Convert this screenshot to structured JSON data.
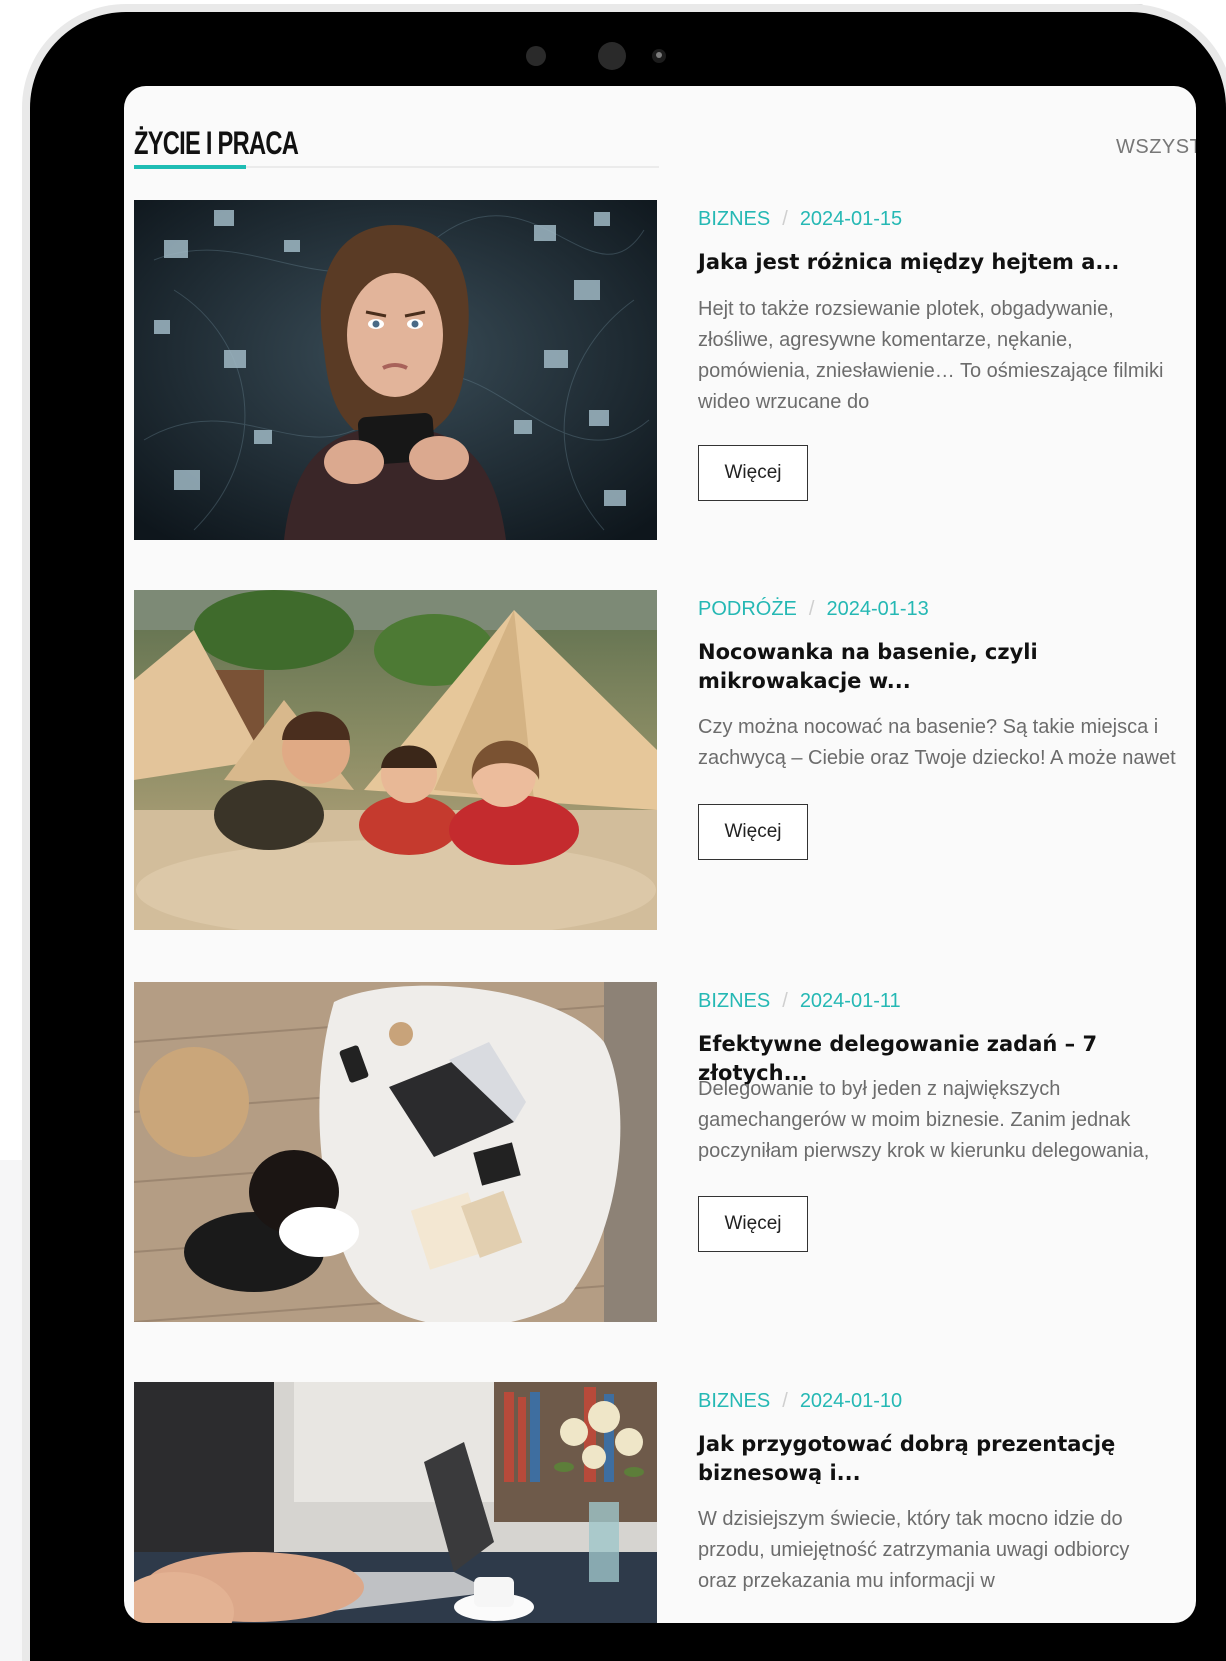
{
  "section": {
    "title": "ŻYCIE I PRACA",
    "see_all": "WSZYST",
    "accent": "#1fbdb4"
  },
  "articles": [
    {
      "category": "BIZNES",
      "date": "2024-01-15",
      "title": "Jaka jest różnica między hejtem a...",
      "excerpt": "Hejt to także rozsiewanie plotek, obgadywanie,\nzłośliwe, agresywne komentarze, nękanie,\npomówienia, zniesławienie… To ośmieszające filmiki\nwideo wrzucane do",
      "more": "Więcej",
      "image": "woman-phone-photo"
    },
    {
      "category": "PODRÓŻE",
      "date": "2024-01-13",
      "title": "Nocowanka na basenie, czyli mikrowakacje w...",
      "excerpt": "Czy można nocować na basenie? Są takie miejsca i\nzachwycą – Ciebie oraz Twoje dziecko! A może nawet",
      "more": "Więcej",
      "image": "kids-tents-photo"
    },
    {
      "category": "BIZNES",
      "date": "2024-01-11",
      "title": "Efektywne delegowanie zadań – 7 złotych...",
      "excerpt": "Delegowanie to był jeden z największych\ngamechangerów w moim biznesie. Zanim jednak\npoczyniłam pierwszy krok w kierunku delegowania,",
      "more": "Więcej",
      "image": "laptop-desk-photo"
    },
    {
      "category": "BIZNES",
      "date": "2024-01-10",
      "title": "Jak przygotować dobrą prezentację biznesową i...",
      "excerpt": "W dzisiejszym świecie, który tak mocno idzie do\nprzodu, umiejętność zatrzymania uwagi odbiorcy\noraz przekazania mu informacji w",
      "more": "Więcej",
      "image": "laptop-flowers-photo"
    }
  ]
}
